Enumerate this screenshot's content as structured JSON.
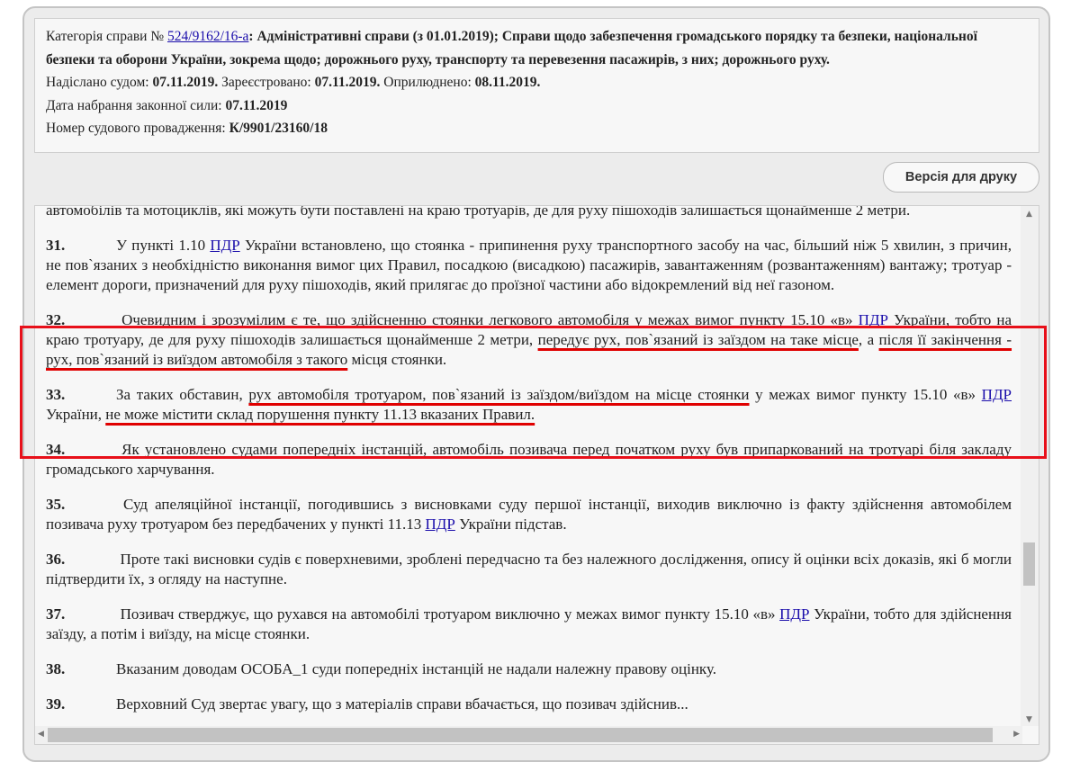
{
  "meta": {
    "category_label": "Категорія справи № ",
    "case_link": "524/9162/16-а",
    "category_text": ": Адміністративні справи (з 01.01.2019); Справи щодо забезпечення громадського порядку та безпеки, національної безпеки та оборони України, зокрема щодо; дорожнього руху, транспорту та перевезення пасажирів, з них; дорожнього руху.",
    "sent_label": "Надіслано судом: ",
    "sent_value": "07.11.2019.",
    "registered_label": " Зареєстровано: ",
    "registered_value": "07.11.2019.",
    "published_label": " Оприлюднено: ",
    "published_value": "08.11.2019.",
    "effective_label": "Дата набрання законної сили: ",
    "effective_value": "07.11.2019",
    "proceeding_label": "Номер судового провадження: ",
    "proceeding_value": "К/9901/23160/18"
  },
  "print_button": "Версія для друку",
  "paragraphs": [
    {
      "num": "",
      "segments": [
        {
          "t": "автомобілів та мотоциклів, які можуть бути поставлені на краю тротуарів, де для руху пішоходів залишається щонайменше 2 метри."
        }
      ]
    },
    {
      "num": "31.",
      "segments": [
        {
          "t": "У пункті 1.10 "
        },
        {
          "t": "ПДР",
          "link": true
        },
        {
          "t": " України встановлено, що стоянка - припинення руху транспортного засобу на час, більший ніж 5 хвилин, з причин, не пов`язаних з необхідністю виконання вимог цих Правил, посадкою (висадкою) пасажирів, завантаженням (розвантаженням) вантажу; тротуар - елемент дороги, призначений для руху пішоходів, який прилягає до проїзної частини або відокремлений від неї газоном."
        }
      ]
    },
    {
      "num": "32.",
      "segments": [
        {
          "t": "  Очевидним і зрозумілим є те, що здійсненню стоянки легкового автомобіля у межах вимог пункту 15.10 «в» "
        },
        {
          "t": "ПДР",
          "link": true
        },
        {
          "t": " України, тобто на краю тротуару, де для руху пішоходів залишається щонайменше 2 метри, "
        },
        {
          "t": "передує рух, пов`язаний із заїздом на таке місце",
          "red": true
        },
        {
          "t": ", а "
        },
        {
          "t": "після її закінчення - рух, пов`язаний із виїздом автомобіля з такого",
          "red": true
        },
        {
          "t": " місця стоянки."
        }
      ]
    },
    {
      "num": "33.",
      "segments": [
        {
          "t": "За таких обставин, "
        },
        {
          "t": "рух автомобіля тротуаром, пов`язаний із заїздом/виїздом на місце стоянки",
          "red": true
        },
        {
          "t": " у межах вимог пункту 15.10 «в» "
        },
        {
          "t": "ПДР",
          "link": true
        },
        {
          "t": " України, "
        },
        {
          "t": "не може містити склад порушення пункту 11.13 вказаних Правил.",
          "red": true
        }
      ]
    },
    {
      "num": "34.",
      "segments": [
        {
          "t": "  Як установлено судами попередніх інстанцій, автомобіль позивача перед початком руху був припаркований на тротуарі біля закладу громадського харчування."
        }
      ]
    },
    {
      "num": "35.",
      "segments": [
        {
          "t": "     Суд апеляційної інстанції, погодившись з висновками суду першої інстанції, виходив виключно із факту здійснення автомобілем позивача руху тротуаром без передбачених у пункті 11.13 "
        },
        {
          "t": "ПДР",
          "link": true
        },
        {
          "t": " України підстав."
        }
      ]
    },
    {
      "num": "36.",
      "segments": [
        {
          "t": "  Проте такі висновки судів є поверхневими, зроблені передчасно та без належного дослідження, опису й оцінки всіх доказів, які б могли підтвердити їх, з огляду на наступне."
        }
      ]
    },
    {
      "num": "37.",
      "segments": [
        {
          "t": "  Позивач стверджує, що рухався на автомобілі тротуаром виключно у межах вимог пункту 15.10 «в» "
        },
        {
          "t": "ПДР",
          "link": true
        },
        {
          "t": " України, тобто для здійснення заїзду, а потім і виїзду, на місце стоянки."
        }
      ]
    },
    {
      "num": "38.",
      "segments": [
        {
          "t": "Вказаним доводам ОСОБА_1 суди попередніх інстанцій не надали належну правову оцінку."
        }
      ]
    },
    {
      "num": "39.",
      "segments": [
        {
          "t": "Верховний Суд звертає увагу, що з матеріалів справи вбачається, що позивач здійснив..."
        }
      ]
    }
  ]
}
